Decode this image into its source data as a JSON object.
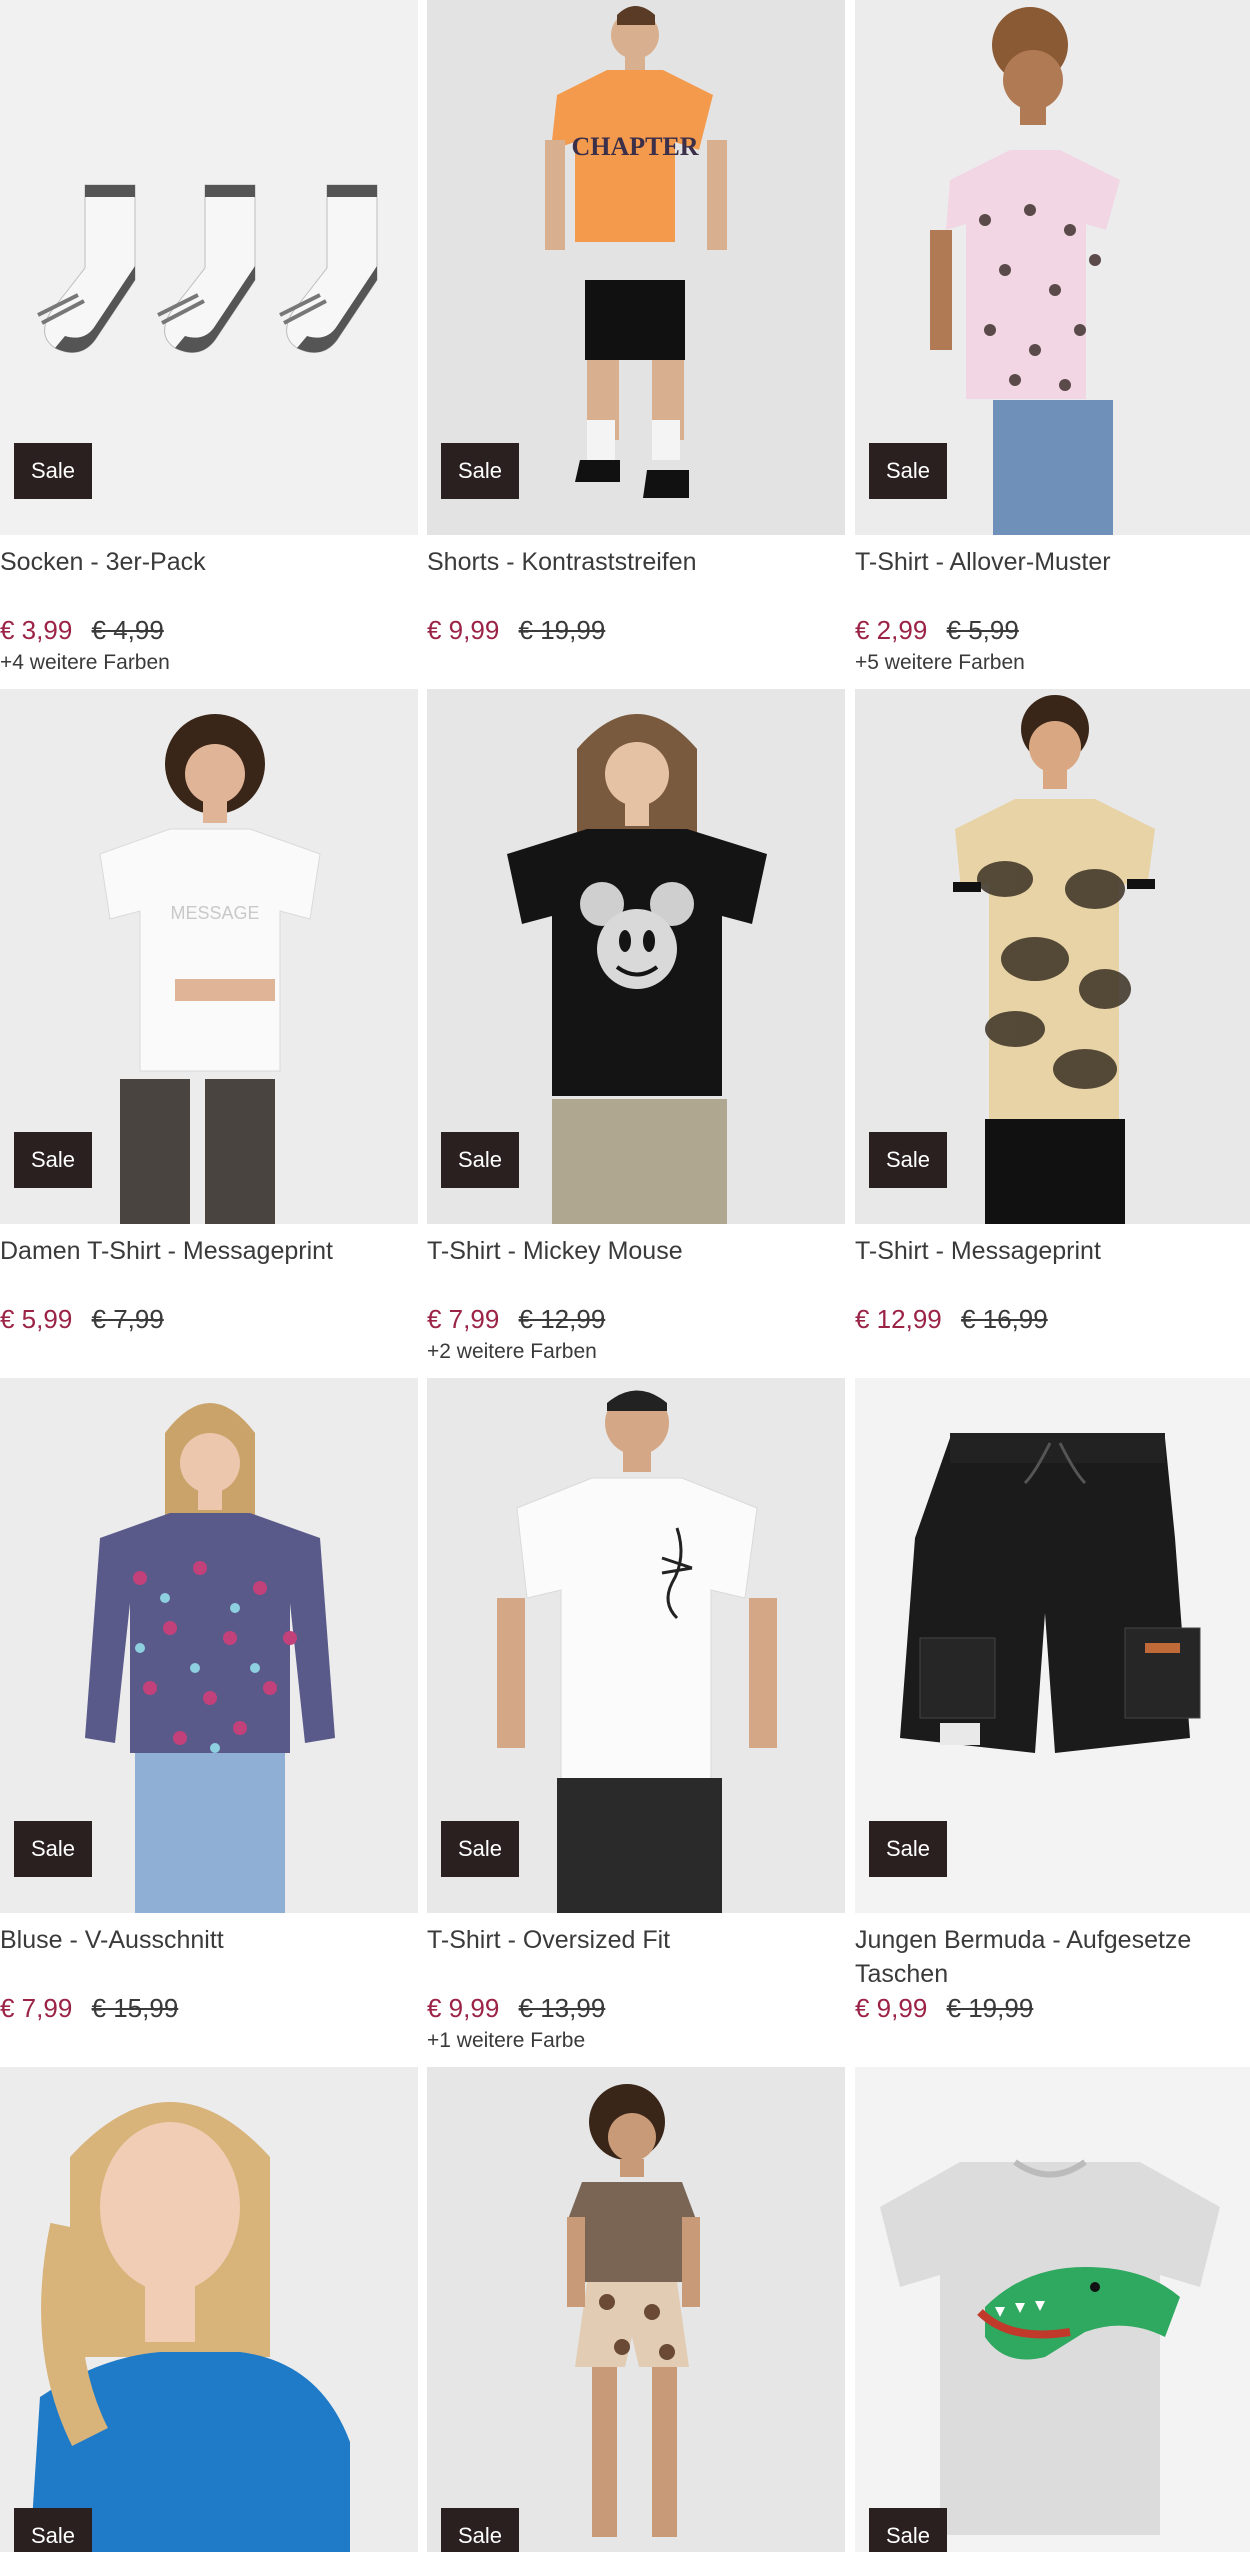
{
  "products": [
    {
      "title": "Socken - 3er-Pack",
      "badge": "Sale",
      "price_new": "€ 3,99",
      "price_old": "€ 4,99",
      "colors": "+4 weitere Farben",
      "image": "socks-image"
    },
    {
      "title": "Shorts - Kontraststreifen",
      "badge": "Sale",
      "price_new": "€ 9,99",
      "price_old": "€ 19,99",
      "colors": "",
      "image": "model-orange-tshirt-black-shorts"
    },
    {
      "title": "T-Shirt - Allover-Muster",
      "badge": "Sale",
      "price_new": "€ 2,99",
      "price_old": "€ 5,99",
      "colors": "+5 weitere Farben",
      "image": "model-pink-patterned-tshirt"
    },
    {
      "title": "Damen T-Shirt - Messageprint",
      "badge": "Sale",
      "price_new": "€ 5,99",
      "price_old": "€ 7,99",
      "colors": "",
      "image": "model-white-tshirt"
    },
    {
      "title": "T-Shirt - Mickey Mouse",
      "badge": "Sale",
      "price_new": "€ 7,99",
      "price_old": "€ 12,99",
      "colors": "+2 weitere Farben",
      "image": "model-black-mickey-tshirt"
    },
    {
      "title": "T-Shirt - Messageprint",
      "badge": "Sale",
      "price_new": "€ 12,99",
      "price_old": "€ 16,99",
      "colors": "",
      "image": "model-tiedye-tshirt"
    },
    {
      "title": "Bluse - V-Ausschnitt",
      "badge": "Sale",
      "price_new": "€ 7,99",
      "price_old": "€ 15,99",
      "colors": "",
      "image": "model-floral-blouse"
    },
    {
      "title": "T-Shirt - Oversized Fit",
      "badge": "Sale",
      "price_new": "€ 9,99",
      "price_old": "€ 13,99",
      "colors": "+1 weitere Farbe",
      "image": "model-white-scorpion-tshirt"
    },
    {
      "title": "Jungen Bermuda - Aufgesetze Taschen",
      "badge": "Sale",
      "price_new": "€ 9,99",
      "price_old": "€ 19,99",
      "colors": "",
      "image": "black-cargo-shorts"
    },
    {
      "title": "",
      "badge": "Sale",
      "price_new": "",
      "price_old": "",
      "colors": "",
      "image": "model-blue-top"
    },
    {
      "title": "",
      "badge": "Sale",
      "price_new": "",
      "price_old": "",
      "colors": "",
      "image": "model-brown-top-print-shorts"
    },
    {
      "title": "",
      "badge": "Sale",
      "price_new": "",
      "price_old": "",
      "colors": "",
      "image": "grey-crocodile-tshirt"
    }
  ],
  "colors": {
    "badge_bg": "#2a2020",
    "price_sale": "#9b2346",
    "image_bg": "#efefef"
  }
}
